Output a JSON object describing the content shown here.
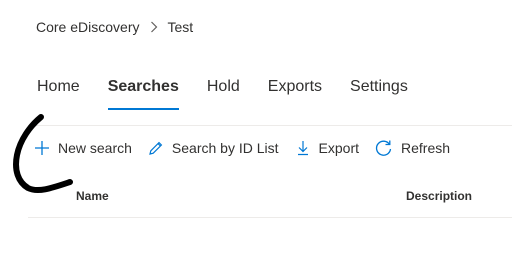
{
  "breadcrumb": {
    "root": "Core eDiscovery",
    "current": "Test",
    "separator_icon": "chevron-right-icon"
  },
  "tabs": [
    {
      "label": "Home",
      "active": false
    },
    {
      "label": "Searches",
      "active": true
    },
    {
      "label": "Hold",
      "active": false
    },
    {
      "label": "Exports",
      "active": false
    },
    {
      "label": "Settings",
      "active": false
    }
  ],
  "toolbar": {
    "new_search": {
      "label": "New search",
      "icon": "plus-icon"
    },
    "search_by_id": {
      "label": "Search by ID List",
      "icon": "pencil-icon"
    },
    "export": {
      "label": "Export",
      "icon": "download-icon"
    },
    "refresh": {
      "label": "Refresh",
      "icon": "refresh-icon"
    }
  },
  "table": {
    "columns": [
      "Name",
      "Description"
    ]
  },
  "colors": {
    "accent": "#0078d4",
    "text": "#323130",
    "divider": "#edebe9",
    "annotation": "#000000"
  }
}
